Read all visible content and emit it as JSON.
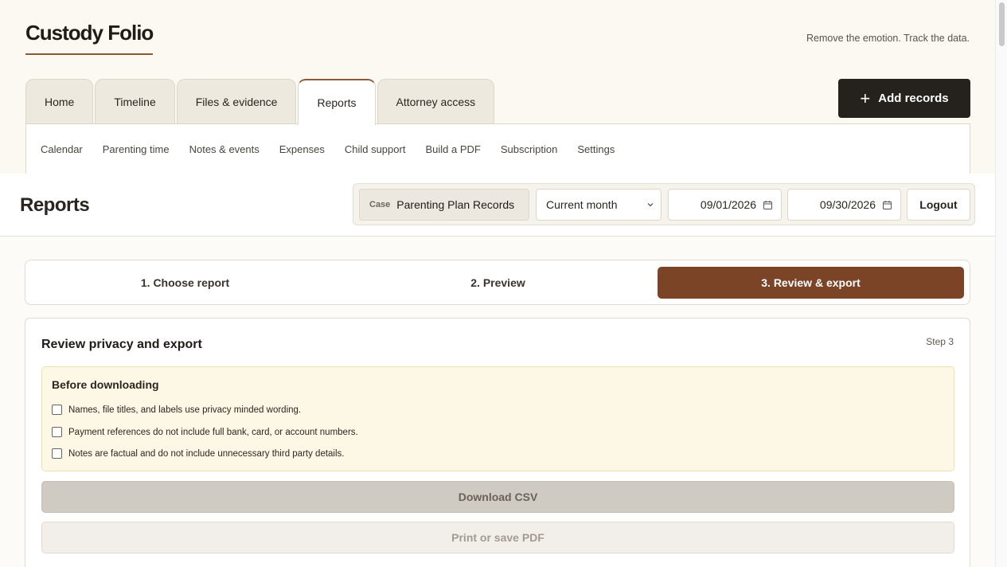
{
  "app": {
    "logo": "Custody Folio",
    "tagline": "Remove the emotion. Track the data."
  },
  "tabs": [
    {
      "label": "Home",
      "active": false
    },
    {
      "label": "Timeline",
      "active": false
    },
    {
      "label": "Files & evidence",
      "active": false
    },
    {
      "label": "Reports",
      "active": true
    },
    {
      "label": "Attorney access",
      "active": false
    }
  ],
  "add_button": {
    "icon": "plus-icon",
    "label": "Add records"
  },
  "subnav": [
    "Calendar",
    "Parenting time",
    "Notes & events",
    "Expenses",
    "Child support",
    "Build a PDF",
    "Subscription",
    "Settings"
  ],
  "page": {
    "title": "Reports"
  },
  "filters": {
    "case_label": "Case",
    "case_value": "Parenting Plan Records",
    "period": "Current month",
    "start_date": "09/01/2026",
    "end_date": "09/30/2026",
    "logout": "Logout"
  },
  "steps": [
    {
      "label": "1. Choose report",
      "active": false
    },
    {
      "label": "2. Preview",
      "active": false
    },
    {
      "label": "3. Review & export",
      "active": true
    }
  ],
  "review": {
    "title": "Review privacy and export",
    "step_tag": "Step 3",
    "notice_title": "Before downloading",
    "checks": [
      "Names, file titles, and labels use privacy minded wording.",
      "Payment references do not include full bank, card, or account numbers.",
      "Notes are factual and do not include unnecessary third party details."
    ],
    "download_csv": "Download CSV",
    "print_pdf": "Print or save PDF"
  },
  "colors": {
    "accent": "#7b4427",
    "dark_button": "#25211d",
    "notice_bg": "#fdf8e6"
  }
}
